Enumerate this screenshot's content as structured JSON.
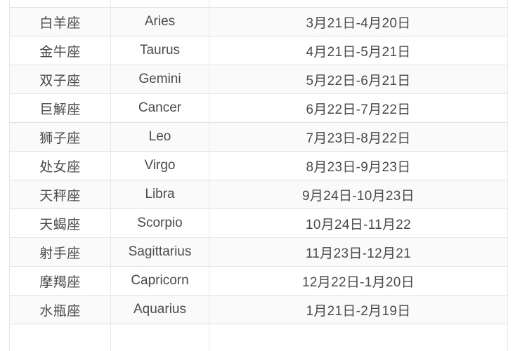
{
  "page": {
    "title": "星座日期对照表",
    "background_color": "#ffffff",
    "border_color": "#e3e3e3",
    "text_color": "#4a4a4a",
    "row_tint_color": "#fafafa"
  },
  "table": {
    "columns": [
      {
        "key": "chinese_name",
        "label": ""
      },
      {
        "key": "english_name",
        "label": ""
      },
      {
        "key": "date_range",
        "label": ""
      }
    ],
    "cropped_top": true,
    "cropped_bottom": true,
    "rows": [
      {
        "chinese_name": "白羊座",
        "english_name": "Aries",
        "date_range": "3月21日-4月20日"
      },
      {
        "chinese_name": "金牛座",
        "english_name": "Taurus",
        "date_range": "4月21日-5月21日"
      },
      {
        "chinese_name": "双子座",
        "english_name": "Gemini",
        "date_range": "5月22日-6月21日"
      },
      {
        "chinese_name": "巨解座",
        "english_name": "Cancer",
        "date_range": "6月22日-7月22日"
      },
      {
        "chinese_name": "狮子座",
        "english_name": "Leo",
        "date_range": "7月23日-8月22日"
      },
      {
        "chinese_name": "处女座",
        "english_name": "Virgo",
        "date_range": "8月23日-9月23日"
      },
      {
        "chinese_name": "天秤座",
        "english_name": "Libra",
        "date_range": "9月24日-10月23日"
      },
      {
        "chinese_name": "天蝎座",
        "english_name": "Scorpio",
        "date_range": "10月24日-11月22"
      },
      {
        "chinese_name": "射手座",
        "english_name": "Sagittarius",
        "date_range": "11月23日-12月21"
      },
      {
        "chinese_name": "摩羯座",
        "english_name": "Capricorn",
        "date_range": "12月22日-1月20日"
      },
      {
        "chinese_name": "水瓶座",
        "english_name": "Aquarius",
        "date_range": "1月21日-2月19日"
      }
    ],
    "partial_row_top": {
      "chinese_name": "",
      "english_name": "",
      "date_range": ""
    },
    "partial_row_bottom": {
      "chinese_name": "",
      "english_name": "",
      "date_range": ""
    }
  }
}
